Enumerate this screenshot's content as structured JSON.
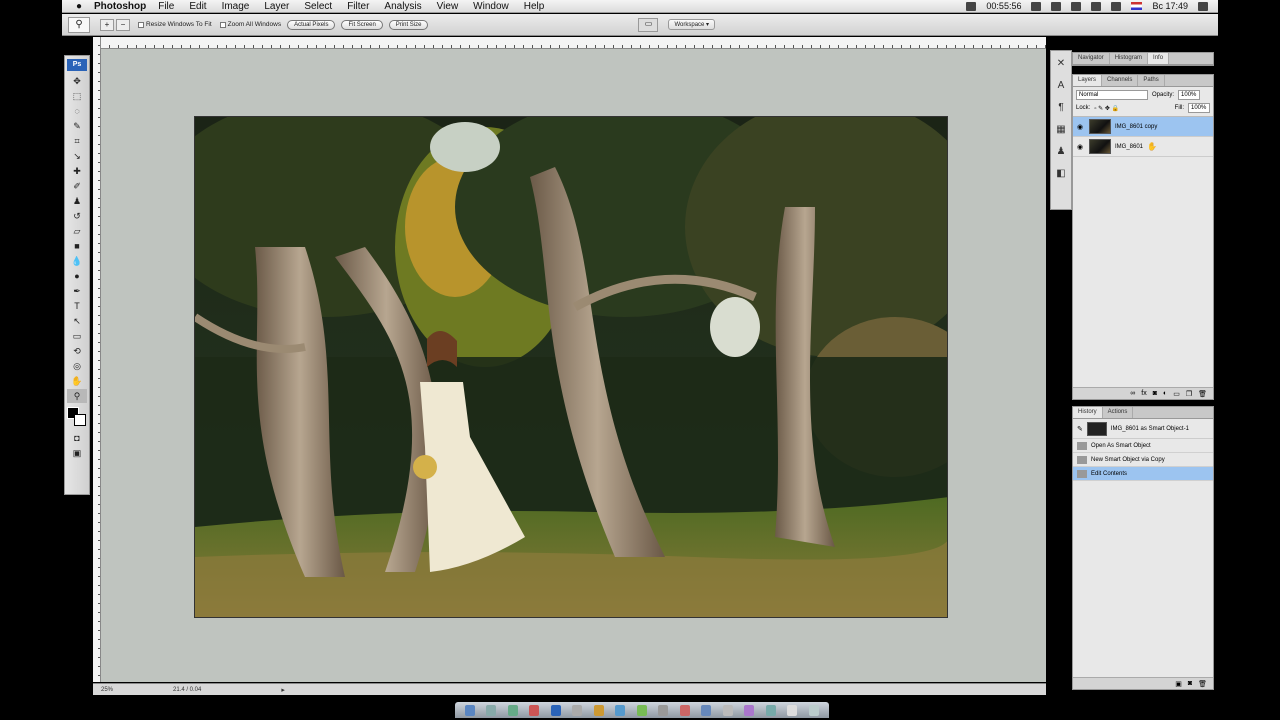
{
  "menubar": {
    "app_name": "Photoshop",
    "items": [
      "File",
      "Edit",
      "Image",
      "Layer",
      "Select",
      "Filter",
      "Analysis",
      "View",
      "Window",
      "Help"
    ],
    "timer": "00:55:56",
    "clock": "Вс 17:49"
  },
  "options": {
    "resize_windows": "Resize Windows To Fit",
    "zoom_all_windows": "Zoom All Windows",
    "actual_pixels": "Actual Pixels",
    "fit_screen": "Fit Screen",
    "print_size": "Print Size",
    "workspace": "Workspace ▾"
  },
  "toolbox": {
    "logo": "Ps"
  },
  "status": {
    "zoom": "25%",
    "doc": "21.4 / 0.04",
    "arrow": "▸"
  },
  "nav_panel": {
    "tabs": [
      "Navigator",
      "Histogram",
      "Info"
    ]
  },
  "layers_panel": {
    "tabs": [
      "Layers",
      "Channels",
      "Paths"
    ],
    "blend_mode": "Normal",
    "opacity_label": "Opacity:",
    "opacity_value": "100%",
    "lock_label": "Lock:",
    "fill_label": "Fill:",
    "fill_value": "100%",
    "layers": [
      {
        "name": "IMG_8601 copy",
        "selected": true
      },
      {
        "name": "IMG_8601",
        "selected": false
      }
    ]
  },
  "history_panel": {
    "tabs": [
      "History",
      "Actions"
    ],
    "snapshot": "IMG_8601 as Smart Object-1",
    "steps": [
      {
        "label": "Open As Smart Object",
        "selected": false
      },
      {
        "label": "New Smart Object via Copy",
        "selected": false
      },
      {
        "label": "Edit Contents",
        "selected": true
      }
    ]
  },
  "colors": {
    "accent": "#2a63b8",
    "selection": "#9cc4f0",
    "canvas_bg": "#bfc4bf"
  }
}
